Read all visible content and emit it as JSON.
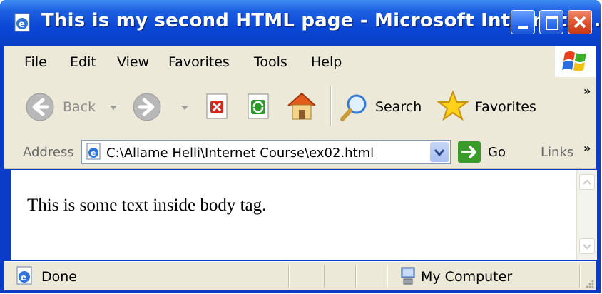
{
  "window": {
    "title": "This is my second HTML page - Microsoft Internet E..."
  },
  "menu": {
    "items": [
      "File",
      "Edit",
      "View",
      "Favorites",
      "Tools",
      "Help"
    ]
  },
  "toolbar": {
    "back_label": "Back",
    "search_label": "Search",
    "favorites_label": "Favorites",
    "overflow": "»"
  },
  "address": {
    "label": "Address",
    "value": "C:\\Allame Helli\\Internet Course\\ex02.html",
    "go_label": "Go",
    "links_label": "Links",
    "overflow": "»"
  },
  "page": {
    "body_text": "This is some text inside body tag."
  },
  "status": {
    "text": "Done",
    "zone": "My Computer"
  },
  "colors": {
    "titlebar": "#0a47d6",
    "chrome": "#ece9d8",
    "go": "#3a9a2a"
  }
}
